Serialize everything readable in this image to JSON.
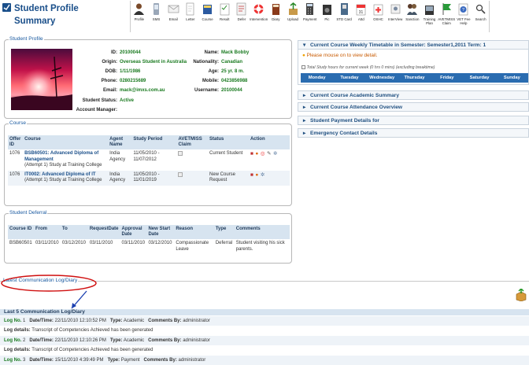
{
  "header": {
    "title_line1": "Student Profile",
    "title_line2": "Summary"
  },
  "toolbar": [
    {
      "label": "Profile",
      "icon": "person-icon"
    },
    {
      "label": "SMS",
      "icon": "phone-icon"
    },
    {
      "label": "Email",
      "icon": "envelope-icon"
    },
    {
      "label": "Letter",
      "icon": "letter-icon"
    },
    {
      "label": "Course",
      "icon": "book-icon"
    },
    {
      "label": "Result",
      "icon": "result-icon"
    },
    {
      "label": "Defer",
      "icon": "defer-icon"
    },
    {
      "label": "Intervention",
      "icon": "lifebuoy-icon"
    },
    {
      "label": "Diary",
      "icon": "diary-icon"
    },
    {
      "label": "Upload",
      "icon": "upload-icon"
    },
    {
      "label": "Payment",
      "icon": "calculator-icon"
    },
    {
      "label": "Pic",
      "icon": "camera-icon"
    },
    {
      "label": "STD Card",
      "icon": "card-icon"
    },
    {
      "label": "Attd",
      "icon": "calendar-icon"
    },
    {
      "label": "OSHC",
      "icon": "hospital-icon"
    },
    {
      "label": "InterView",
      "icon": "interview-icon"
    },
    {
      "label": "Sanction",
      "icon": "sanction-icon"
    },
    {
      "label": "Training Plan",
      "icon": "training-icon"
    },
    {
      "label": "AVETMISS Claim",
      "icon": "flag-icon"
    },
    {
      "label": "VET Fee Help",
      "icon": "help-icon"
    },
    {
      "label": "Search",
      "icon": "search-icon"
    }
  ],
  "profile": {
    "legend": "Student Profile",
    "left": [
      {
        "k": "ID:",
        "v": "20100044"
      },
      {
        "k": "Origin:",
        "v": "Overseas Student in Australia"
      },
      {
        "k": "DOB:",
        "v": "1/11/1986"
      },
      {
        "k": "Phone:",
        "v": "0280215689"
      },
      {
        "k": "Email:",
        "v": "mack@imxs.com.au"
      },
      {
        "k": "Student Status:",
        "v": "Active"
      },
      {
        "k": "Account Manager:",
        "v": ""
      }
    ],
    "right": [
      {
        "k": "Name:",
        "v": "Mack Bobby"
      },
      {
        "k": "Nationality:",
        "v": "Canadian"
      },
      {
        "k": "Age:",
        "v": "25 yr. 8 m."
      },
      {
        "k": "Mobile:",
        "v": "0423856988"
      },
      {
        "k": "Username:",
        "v": "20100044"
      }
    ]
  },
  "course": {
    "legend": "Course",
    "headers": [
      "Offer ID",
      "Course",
      "Agent Name",
      "Study Period",
      "AVETMISS Claim",
      "Status",
      "Action"
    ],
    "rows": [
      {
        "offer": "1076",
        "code": "BSB60501: Advanced Diploma of Management",
        "attempt": "(Attempt 1) Study at Training College",
        "agent": "India Agency",
        "period": "11/05/2010 - 11/07/2012",
        "status": "Current Student"
      },
      {
        "offer": "1076",
        "code": "IT0002: Advanced Diploma of IT",
        "attempt": "(Attempt 1) Study at Training College",
        "agent": "India Agency",
        "period": "11/05/2010 - 11/01/2019",
        "status": "New Course Request"
      }
    ]
  },
  "deferral": {
    "legend": "Student Deferral",
    "headers": [
      "Course ID",
      "From",
      "To",
      "RequestDate",
      "Approval Date",
      "New Start Date",
      "Reason",
      "Type",
      "Comments"
    ],
    "rows": [
      [
        "BSB60501",
        "03/11/2010",
        "03/12/2010",
        "03/11/2010",
        "03/11/2010",
        "03/12/2010",
        "Compassionate Leave",
        "Deferral",
        "Student visiting his sick parents."
      ]
    ]
  },
  "timetable": {
    "header": "Current Course Weekly Timetable in Semester: Semester1,2011 Term: 1",
    "hint": "Please mouse on to view detail.",
    "total": "Total Study hours for current week (0 hrs 0 mins) (excluding breaktime)",
    "days": [
      "Monday",
      "Tuesday",
      "Wednesday",
      "Thursday",
      "Friday",
      "Saturday",
      "Sunday"
    ]
  },
  "accordions": [
    "Current Course Academic Summary",
    "Current Course Attendance Overview",
    "Student Payment Details for",
    "Emergency Contact Details"
  ],
  "communication": {
    "legend": "Latest Communication Log/Diary",
    "table_title": "Last 5 Communication Log/Diary",
    "log_label": "Log No.",
    "date_label": "Date/Time:",
    "type_label": "Type:",
    "by_label": "Comments By:",
    "details_label": "Log details:",
    "logs": [
      {
        "no": "1",
        "date": "22/11/2010 12:10:52 PM",
        "type": "Academic",
        "by": "administrator",
        "details": "Transcript of Competencies Achieved has been generated"
      },
      {
        "no": "2",
        "date": "22/11/2010 12:10:26 PM",
        "type": "Academic",
        "by": "administrator",
        "details": "Transcript of Competencies Achieved has been generated"
      },
      {
        "no": "3",
        "date": "15/11/2010 4:39:49 PM",
        "type": "Payment",
        "by": "administrator",
        "details": ""
      }
    ]
  },
  "colors": {
    "accent": "#1a4f8a",
    "green": "#1a7a20",
    "annotation": "#d01010",
    "arrow": "#1a3fb0"
  }
}
